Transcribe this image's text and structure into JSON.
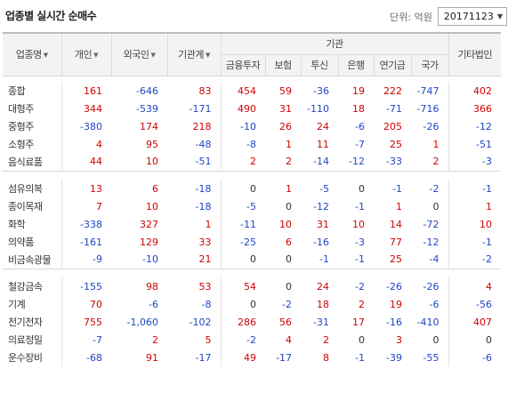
{
  "title": "업종별 실시간 순매수",
  "unit_label": "단위: 억원",
  "date": "20171123",
  "headers": {
    "sector": "업종명",
    "individual": "개인",
    "foreign": "외국인",
    "inst_total": "기관계",
    "institution": "기관",
    "financial": "금융투자",
    "insurance": "보험",
    "trust": "투신",
    "bank": "은행",
    "pension": "연기금",
    "nation": "국가",
    "other_corp": "기타법인"
  },
  "groups": [
    {
      "rows": [
        {
          "name": "종합",
          "values": [
            161,
            -646,
            83,
            454,
            59,
            -36,
            19,
            222,
            -747,
            402
          ]
        },
        {
          "name": "대형주",
          "values": [
            344,
            -539,
            -171,
            490,
            31,
            -110,
            18,
            -71,
            -716,
            366
          ]
        },
        {
          "name": "중형주",
          "values": [
            -380,
            174,
            218,
            -10,
            26,
            24,
            -6,
            205,
            -26,
            -12
          ]
        },
        {
          "name": "소형주",
          "values": [
            4,
            95,
            -48,
            -8,
            1,
            11,
            -7,
            25,
            1,
            -51
          ]
        },
        {
          "name": "음식료품",
          "values": [
            44,
            10,
            -51,
            2,
            2,
            -14,
            -12,
            -33,
            2,
            -3
          ]
        }
      ]
    },
    {
      "rows": [
        {
          "name": "섬유의복",
          "values": [
            13,
            6,
            -18,
            0,
            1,
            -5,
            0,
            -1,
            -2,
            -1
          ]
        },
        {
          "name": "종이목재",
          "values": [
            7,
            10,
            -18,
            -5,
            0,
            -12,
            -1,
            1,
            0,
            1
          ]
        },
        {
          "name": "화학",
          "values": [
            -338,
            327,
            1,
            -11,
            10,
            31,
            10,
            14,
            -72,
            10
          ]
        },
        {
          "name": "의약품",
          "values": [
            -161,
            129,
            33,
            -25,
            6,
            -16,
            -3,
            77,
            -12,
            -1
          ]
        },
        {
          "name": "비금속광물",
          "values": [
            -9,
            -10,
            21,
            0,
            0,
            -1,
            -1,
            25,
            -4,
            -2
          ]
        }
      ]
    },
    {
      "rows": [
        {
          "name": "철강금속",
          "values": [
            -155,
            98,
            53,
            54,
            0,
            24,
            -2,
            -26,
            -26,
            4
          ]
        },
        {
          "name": "기계",
          "values": [
            70,
            -6,
            -8,
            0,
            -2,
            18,
            2,
            19,
            -6,
            -56
          ]
        },
        {
          "name": "전기전자",
          "values": [
            755,
            "-1,060",
            -102,
            286,
            56,
            -31,
            17,
            -16,
            -410,
            407
          ]
        },
        {
          "name": "의료정밀",
          "values": [
            -7,
            2,
            5,
            -2,
            4,
            2,
            0,
            3,
            0,
            0
          ]
        },
        {
          "name": "운수장비",
          "values": [
            -68,
            91,
            -17,
            49,
            -17,
            8,
            -1,
            -39,
            -55,
            -6
          ]
        }
      ]
    }
  ]
}
